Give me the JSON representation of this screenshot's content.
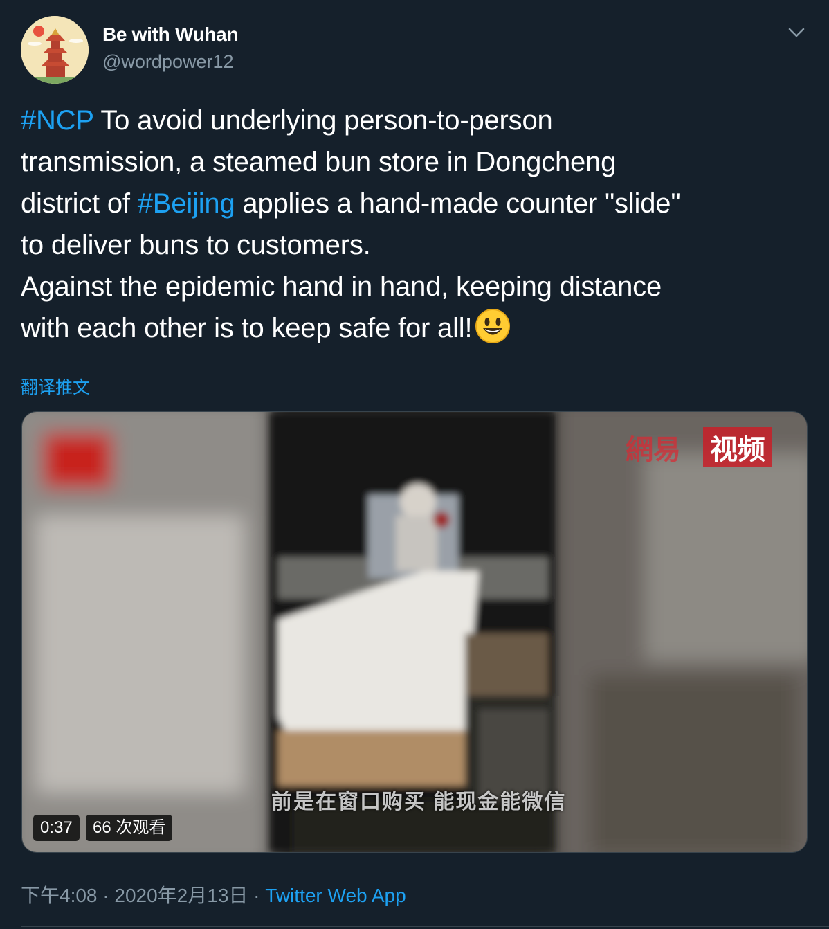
{
  "author": {
    "name": "Be with Wuhan",
    "handle": "@wordpower12",
    "avatar_icon": "yellow-crane-tower-avatar"
  },
  "tweet": {
    "lines": [
      {
        "hashtag": "#NCP",
        "text": " To avoid underlying person-to-person"
      },
      {
        "text": "transmission, a steamed bun store in Dongcheng"
      },
      {
        "pre": "district of ",
        "hashtag": "#Beijing",
        "post": " applies a hand-made counter \"slide\""
      },
      {
        "text": "to deliver buns to customers."
      },
      {
        "text": "Against the epidemic hand in hand, keeping distance"
      },
      {
        "text": "with each other is to keep safe for all!"
      }
    ],
    "emoji": "smiling-face-emoji"
  },
  "translate_label": "翻译推文",
  "video": {
    "duration": "0:37",
    "views": "66 次观看",
    "subtitle": "前是在窗口购买 能现金能微信",
    "watermark_left": "網易",
    "watermark_right": "视频"
  },
  "meta": {
    "time": "下午4:08",
    "separator": " · ",
    "date": "2020年2月13日",
    "source": "Twitter Web App"
  },
  "colors": {
    "background": "#15202b",
    "link": "#1da1f2",
    "secondary": "#8899a6"
  }
}
